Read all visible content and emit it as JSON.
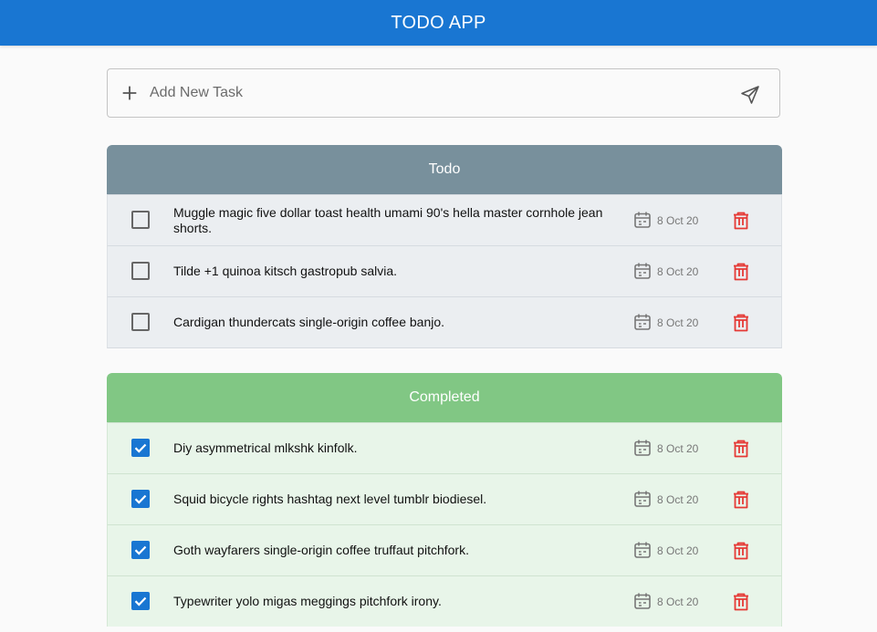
{
  "app": {
    "title": "TODO APP"
  },
  "add_task": {
    "placeholder": "Add New Task"
  },
  "todo": {
    "header": "Todo",
    "header_color": "#78909c",
    "items": [
      {
        "text": "Muggle magic five dollar toast health umami 90's hella master cornhole jean shorts.",
        "date": "8 Oct 20",
        "checked": false
      },
      {
        "text": "Tilde +1 quinoa kitsch gastropub salvia.",
        "date": "8 Oct 20",
        "checked": false
      },
      {
        "text": "Cardigan thundercats single-origin coffee banjo.",
        "date": "8 Oct 20",
        "checked": false
      }
    ]
  },
  "completed": {
    "header": "Completed",
    "header_color": "#81c784",
    "items": [
      {
        "text": "Diy asymmetrical mlkshk kinfolk.",
        "date": "8 Oct 20",
        "checked": true
      },
      {
        "text": "Squid bicycle rights hashtag next level tumblr biodiesel.",
        "date": "8 Oct 20",
        "checked": true
      },
      {
        "text": "Goth wayfarers single-origin coffee truffaut pitchfork.",
        "date": "8 Oct 20",
        "checked": true
      },
      {
        "text": "Typewriter yolo migas meggings pitchfork irony.",
        "date": "8 Oct 20",
        "checked": true
      }
    ]
  },
  "colors": {
    "primary": "#1976d2",
    "delete": "#e53935"
  },
  "icons": {
    "add": "plus-icon",
    "send": "send-icon",
    "date": "calendar-icon",
    "delete": "trash-icon"
  }
}
